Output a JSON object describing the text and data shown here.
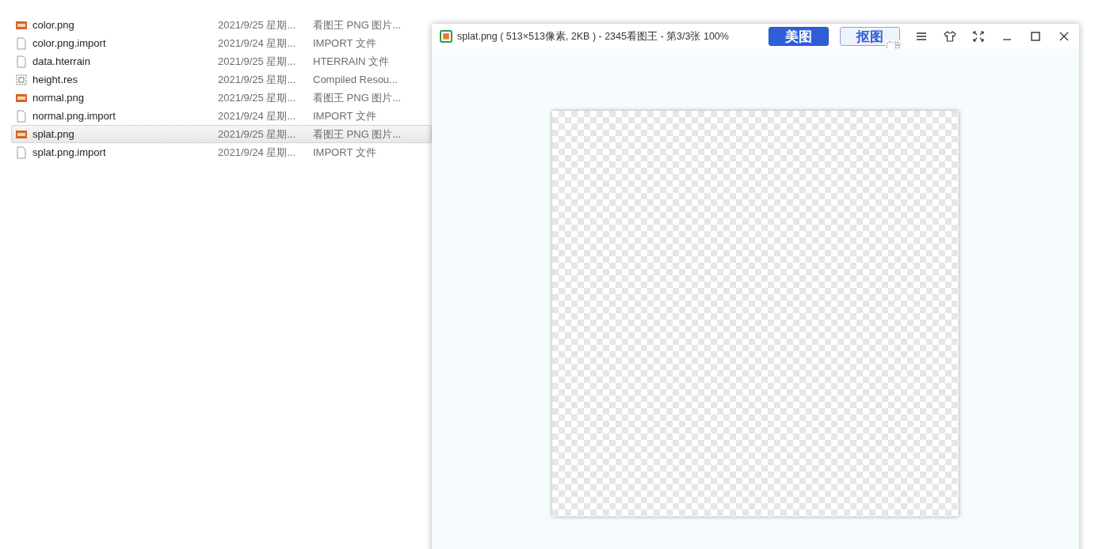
{
  "files": [
    {
      "name": "color.png",
      "kind": "png",
      "date": "2021/9/25 星期...",
      "type": "看图王 PNG 图片...",
      "selected": false
    },
    {
      "name": "color.png.import",
      "kind": "file",
      "date": "2021/9/24 星期...",
      "type": "IMPORT 文件",
      "selected": false
    },
    {
      "name": "data.hterrain",
      "kind": "file",
      "date": "2021/9/25 星期...",
      "type": "HTERRAIN 文件",
      "selected": false
    },
    {
      "name": "height.res",
      "kind": "res",
      "date": "2021/9/25 星期...",
      "type": "Compiled Resou...",
      "selected": false
    },
    {
      "name": "normal.png",
      "kind": "png",
      "date": "2021/9/25 星期...",
      "type": "看图王 PNG 图片...",
      "selected": false
    },
    {
      "name": "normal.png.import",
      "kind": "file",
      "date": "2021/9/24 星期...",
      "type": "IMPORT 文件",
      "selected": false
    },
    {
      "name": "splat.png",
      "kind": "png",
      "date": "2021/9/25 星期...",
      "type": "看图王 PNG 图片...",
      "selected": true
    },
    {
      "name": "splat.png.import",
      "kind": "file",
      "date": "2021/9/24 星期...",
      "type": "IMPORT 文件",
      "selected": false
    }
  ],
  "viewer": {
    "title": "splat.png ( 513×513像素, 2KB ) - 2345看图王 - 第3/3张 100%",
    "primary_button": "美图",
    "secondary_button": "抠图",
    "ad_label": "广告"
  }
}
